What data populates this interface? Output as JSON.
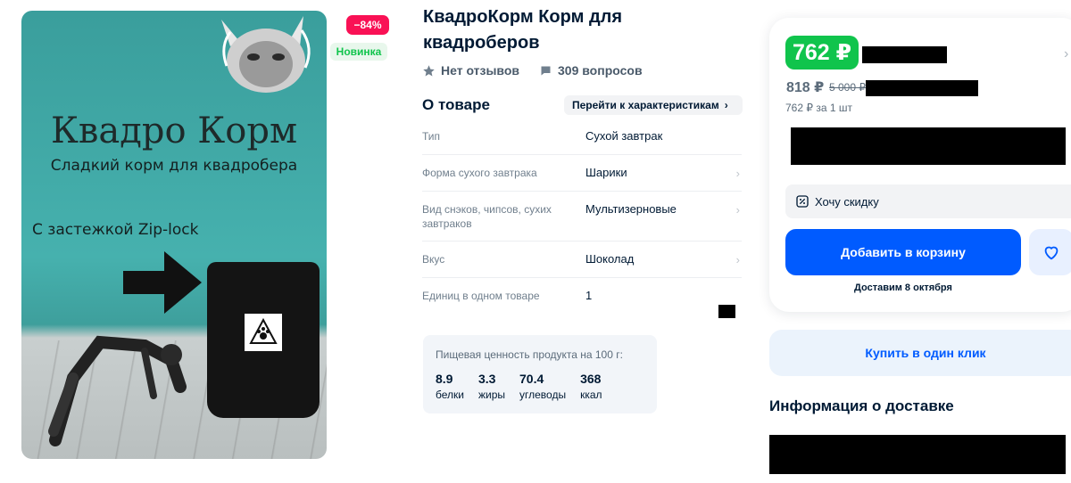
{
  "product": {
    "image": {
      "title": "Квадро Корм",
      "subtitle": "Сладкий корм для квадробера",
      "ziplock": "С застежкой Zip-lock"
    },
    "badges": {
      "discount": "−84%",
      "new": "Новинка"
    },
    "title": "КвадроКорм Корм для квадроберов",
    "reviews": "Нет отзывов",
    "questions": "309 вопросов"
  },
  "about": {
    "title": "О товаре",
    "to_specs": "Перейти к характеристикам",
    "specs": [
      {
        "key": "Тип",
        "value": "Сухой завтрак"
      },
      {
        "key": "Форма сухого завтрака",
        "value": "Шарики"
      },
      {
        "key": "Вид снэков, чипсов, сухих завтраков",
        "value": "Мультизерновые"
      },
      {
        "key": "Вкус",
        "value": "Шоколад"
      },
      {
        "key": "Единиц в одном товаре",
        "value": "1"
      }
    ]
  },
  "nutrition": {
    "label": "Пищевая ценность продукта на 100 г:",
    "items": [
      {
        "value": "8.9",
        "unit": "белки"
      },
      {
        "value": "3.3",
        "unit": "жиры"
      },
      {
        "value": "70.4",
        "unit": "углеводы"
      },
      {
        "value": "368",
        "unit": "ккал"
      }
    ]
  },
  "buy": {
    "price": "762 ₽",
    "old_price": "818 ₽",
    "strike_price": "5 000 ₽",
    "per_unit": "762 ₽ за 1 шт",
    "want_discount": "Хочу скидку",
    "add_to_cart": "Добавить в корзину",
    "delivery_date": "Доставим 8 октября",
    "one_click": "Купить в один клик"
  },
  "delivery": {
    "title": "Информация о доставке"
  },
  "colors": {
    "accent": "#005bff",
    "price_green": "#10c44c",
    "discount_pink": "#f91155"
  }
}
